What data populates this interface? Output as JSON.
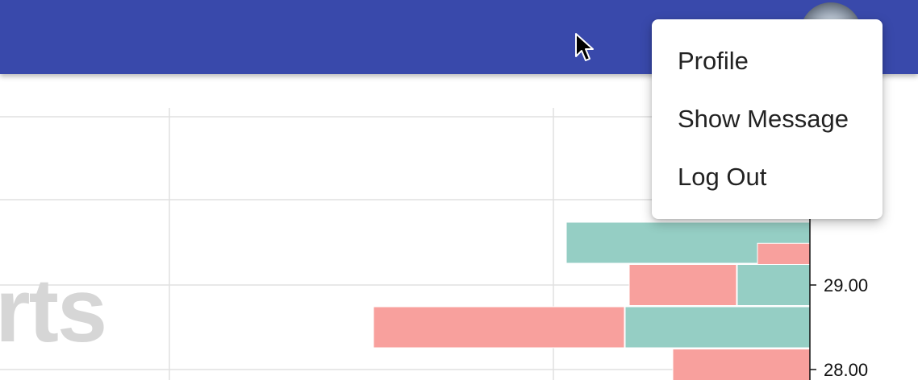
{
  "header": {
    "background_color": "#3949ab",
    "avatar_icon": "user-avatar-icon"
  },
  "account_menu": {
    "items": [
      {
        "label": "Profile"
      },
      {
        "label": "Show Message"
      },
      {
        "label": "Log Out"
      }
    ]
  },
  "background_text": {
    "watermark": "rts"
  },
  "colors": {
    "series_teal": "#95cec4",
    "series_pink": "#f8a09d",
    "grid": "#e0e0e0"
  },
  "cursor_icon": "mouse-pointer-icon",
  "chart_data": {
    "type": "bar",
    "orientation": "horizontal",
    "y_tick_labels": [
      "29.00",
      "28.00"
    ],
    "y_ticks": [
      29.0,
      28.0
    ],
    "bars": [
      {
        "category": 29.5,
        "series": "teal",
        "length": 302
      },
      {
        "category": 29.25,
        "series": "pink",
        "length": 65
      },
      {
        "category": 29.0,
        "series": "pink",
        "length": 133
      },
      {
        "category": 29.0,
        "series": "teal",
        "length": 90
      },
      {
        "category": 28.5,
        "series": "pink",
        "length": 311
      },
      {
        "category": 28.5,
        "series": "teal",
        "length": 229
      },
      {
        "category": 28.0,
        "series": "pink",
        "length": 170
      }
    ],
    "grid": true
  }
}
